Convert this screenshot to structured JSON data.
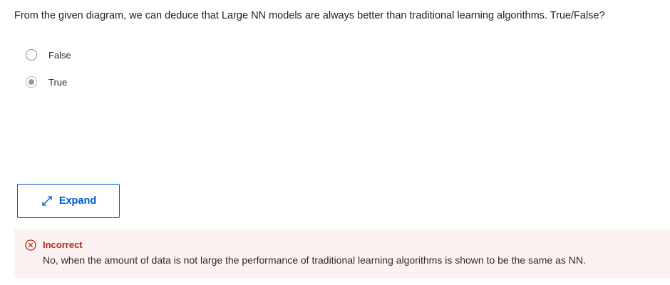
{
  "question": {
    "text": "From the given diagram, we can deduce that Large NN models are always better than traditional learning algorithms. True/False?"
  },
  "options": [
    {
      "label": "False",
      "selected": false
    },
    {
      "label": "True",
      "selected": true
    }
  ],
  "expand_button": {
    "label": "Expand",
    "icon": "expand-arrows-icon"
  },
  "feedback": {
    "status": "Incorrect",
    "icon": "x-circle-icon",
    "message": "No, when the amount of data is not large the performance of traditional learning algorithms is shown to be the same as NN.",
    "color": "#b3261e",
    "background": "#fdf2f2"
  },
  "accent_color": "#0056d2"
}
